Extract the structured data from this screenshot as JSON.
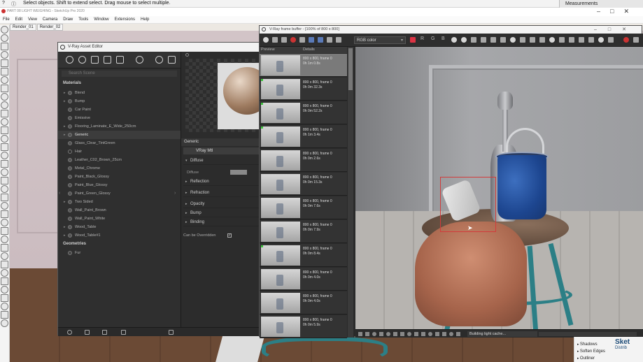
{
  "statusbar": {
    "hint": "Select objects. Shift to extend select. Drag mouse to select multiple.",
    "measurements_label": "Measurements"
  },
  "titlebar": {
    "title": "PART 08 LIGHT WEIGHING - SketchUp Pro 2020"
  },
  "menu": [
    "File",
    "Edit",
    "View",
    "Camera",
    "Draw",
    "Tools",
    "Window",
    "Extensions",
    "Help"
  ],
  "scene_tabs": [
    "Render_01",
    "Render_02"
  ],
  "asset_editor": {
    "title": "V-Ray Asset Editor",
    "search_placeholder": "Search Scene",
    "materials_label": "Materials",
    "materials": [
      "Blend",
      "Bump",
      "Car Paint",
      "Emissive",
      "Flooring_Laminate_E_Wide_250cm",
      "Generic",
      "Glass_Clear_TintGreen",
      "Hair",
      "Leather_C02_Brown_25cm",
      "Metal_Chrome",
      "Paint_Black_Glossy",
      "Paint_Blue_Glossy",
      "Paint_Green_Glossy",
      "Two Sided",
      "Wall_Paint_Brown",
      "Wall_Paint_White",
      "Wood_Table",
      "Wood_Table#1"
    ],
    "selected_material": "Generic",
    "geometries_label": "Geometries",
    "geometries": [
      "Fur"
    ],
    "properties": {
      "header": "Generic",
      "mtl_name": "VRay Mtl",
      "sections": [
        "Diffuse",
        "Reflection",
        "Refraction",
        "Opacity",
        "Bump",
        "Binding"
      ],
      "diffuse_label": "Diffuse",
      "override_label": "Can be Overridden",
      "override_checked": true
    }
  },
  "vfb": {
    "title": "V-Ray frame buffer - [100% of 800 x 800]",
    "channel": "RGB color",
    "history_cols": [
      "Preview",
      "Details"
    ],
    "history": [
      "800 x 800, frame 0\n0h 1m 0.8s",
      "800 x 800, frame 0\n0h 0m 32.3s",
      "800 x 800, frame 0\n0h 0m 52.2s",
      "800 x 800, frame 0\n0h 1m 3.4s",
      "800 x 800, frame 0\n0h 0m 2.6s",
      "800 x 800, frame 0\n0h 0m 15.3s",
      "800 x 800, frame 0\n0h 0m 7.6s",
      "800 x 800, frame 0\n0h 0m 7.9s",
      "800 x 800, frame 0\n0h 0m 8.4s",
      "800 x 800, frame 0\n0h 0m 4.0s",
      "800 x 800, frame 0\n0h 0m 4.0s",
      "800 x 800, frame 0\n0h 0m 5.9s"
    ],
    "status_message": "Building light cache..."
  },
  "tray": {
    "items": [
      "Shadows",
      "Soften Edges",
      "Outliner"
    ],
    "brand": "Sket",
    "brand_sub": "Distrib"
  },
  "colors": {
    "vray_dark": "#2b2b2b",
    "selection_red": "#d23b3b",
    "history_flag": "#3ec43e"
  }
}
